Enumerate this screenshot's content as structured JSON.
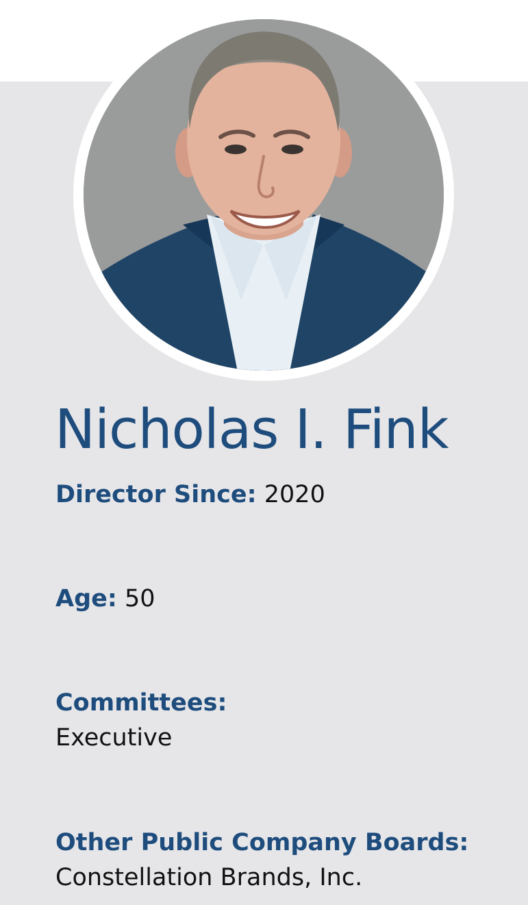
{
  "profile": {
    "name": "Nicholas I. Fink",
    "director_since_label": "Director Since:",
    "director_since_value": "2020",
    "age_label": "Age:",
    "age_value": "50",
    "committees_label": "Committees:",
    "committees_value": "Executive",
    "boards_label": "Other Public Company Boards:",
    "boards_value": "Constellation Brands, Inc."
  },
  "colors": {
    "accent": "#1e4d7d",
    "panel_background": "#e6e6e9",
    "photo_background": "#9a9b9b",
    "text": "#111111"
  }
}
